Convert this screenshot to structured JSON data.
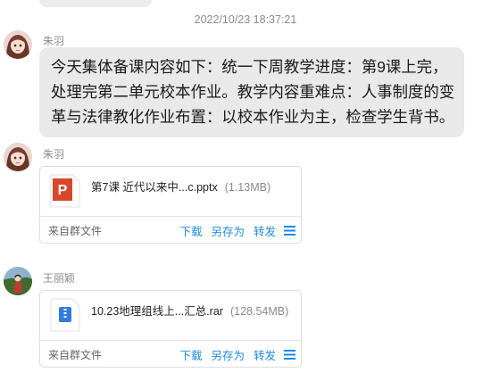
{
  "timestamp": "2022/10/23 18:37:21",
  "messages": [
    {
      "sender": "朱羽",
      "text": "今天集体备课内容如下：统一下周教学进度：第9课上完，处理完第二单元校本作业。教学内容重难点：人事制度的变革与法律教化作业布置：以校本作业为主，检查学生背书。"
    },
    {
      "sender": "朱羽",
      "file": {
        "icon": "ppt-file-icon",
        "name": "第7课 近代以来中...c.pptx",
        "size": "(1.13MB)",
        "source": "来自群文件",
        "actions": [
          "下载",
          "另存为",
          "转发"
        ]
      }
    },
    {
      "sender": "王丽颖",
      "file": {
        "icon": "zip-file-icon",
        "name": "10.23地理组线上...汇总.rar",
        "size": "(128.54MB)",
        "source": "来自群文件",
        "actions": [
          "下载",
          "另存为",
          "转发"
        ]
      }
    }
  ],
  "colors": {
    "link": "#1e8ae6",
    "ppt": "#d9472b",
    "zip": "#2f7de1"
  }
}
